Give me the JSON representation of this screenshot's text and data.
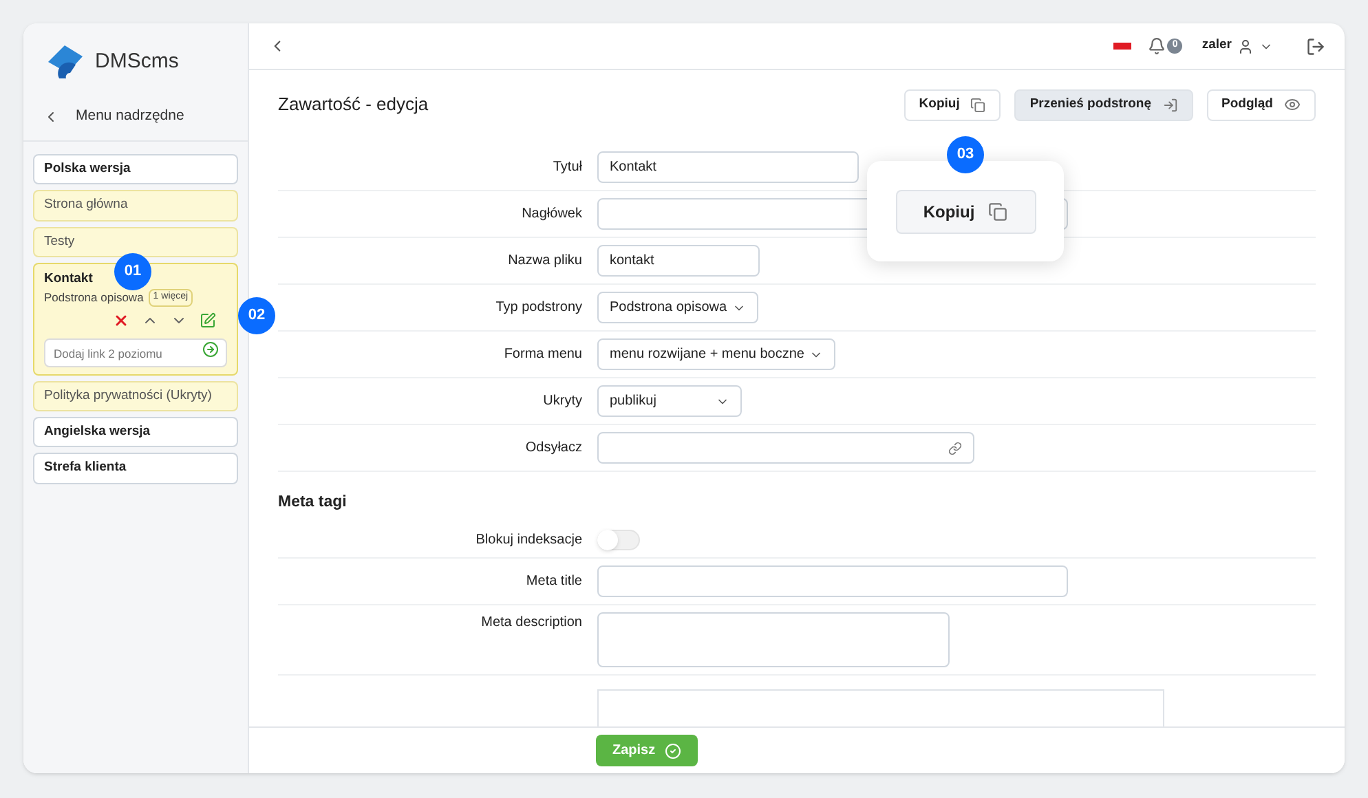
{
  "logo": {
    "text": "DMScms"
  },
  "sidebar": {
    "back_label": "Menu nadrzędne",
    "items": [
      {
        "label": "Polska wersja",
        "kind": "section"
      },
      {
        "label": "Strona główna",
        "kind": "page"
      },
      {
        "label": "Testy",
        "kind": "page"
      },
      {
        "label": "Kontakt",
        "kind": "expanded",
        "subtitle": "Podstrona opisowa",
        "badge": "1 więcej",
        "add_placeholder": "Dodaj link 2 poziomu"
      },
      {
        "label": "Polityka prywatności (Ukryty)",
        "kind": "page"
      },
      {
        "label": "Angielska wersja",
        "kind": "section"
      },
      {
        "label": "Strefa klienta",
        "kind": "section"
      }
    ]
  },
  "header": {
    "notifications": "0",
    "user": "zaler"
  },
  "page": {
    "title": "Zawartość - edycja",
    "buttons": [
      {
        "label": "Kopiuj",
        "kind": "copy"
      },
      {
        "label": "Przenieś podstronę",
        "kind": "move"
      },
      {
        "label": "Podgląd",
        "kind": "preview"
      }
    ]
  },
  "form": [
    {
      "label": "Tytuł",
      "kind": "text",
      "value": "Kontakt"
    },
    {
      "label": "Nagłówek",
      "kind": "text"
    },
    {
      "label": "Nazwa pliku",
      "kind": "text",
      "value": "kontakt"
    },
    {
      "label": "Typ podstrony",
      "kind": "select",
      "value": "Podstrona opisowa"
    },
    {
      "label": "Forma menu",
      "kind": "select",
      "value": "menu rozwijane + menu boczne"
    },
    {
      "label": "Ukryty",
      "kind": "select",
      "value": "publikuj"
    },
    {
      "label": "Odsyłacz",
      "kind": "link"
    }
  ],
  "meta": {
    "title": "Meta tagi",
    "fields": [
      {
        "label": "Blokuj indeksacje",
        "kind": "toggle",
        "on": false
      },
      {
        "label": "Meta title",
        "kind": "text"
      },
      {
        "label": "Meta description",
        "kind": "textarea"
      }
    ]
  },
  "footer": {
    "save": "Zapisz"
  },
  "callouts": [
    "01",
    "02",
    "03"
  ],
  "popup": {
    "button": "Kopiuj"
  }
}
